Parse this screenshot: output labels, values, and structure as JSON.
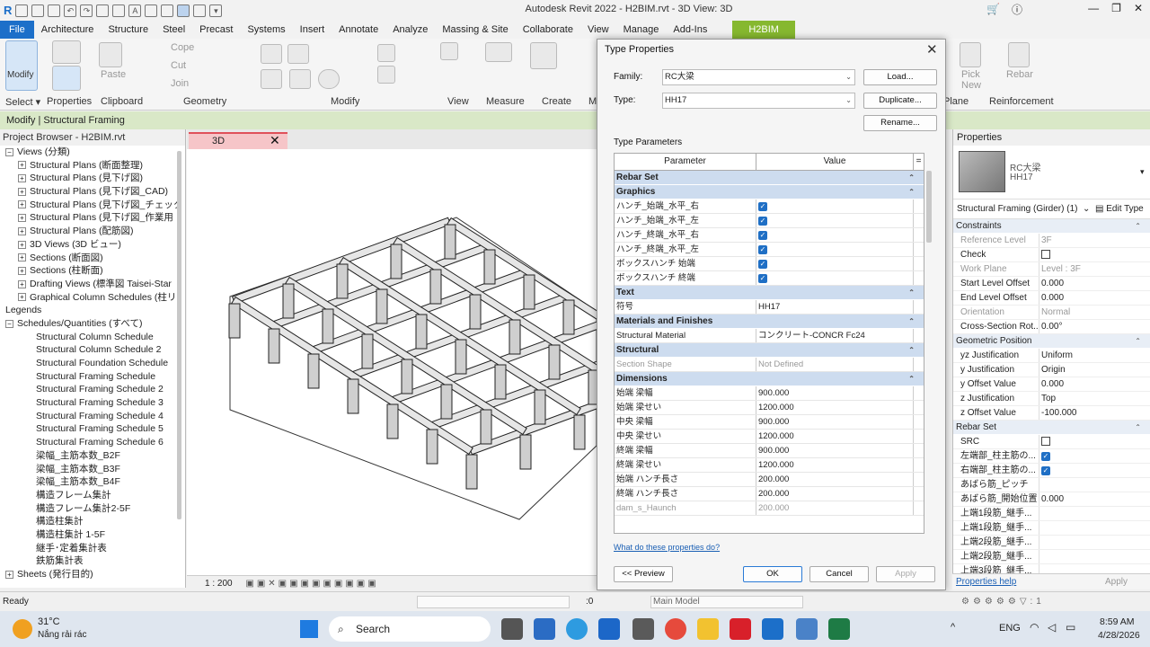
{
  "app": {
    "title": "Autodesk Revit 2022 - H2BIM.rvt - 3D View: 3D"
  },
  "ribbon_tabs": [
    "File",
    "Architecture",
    "Structure",
    "Steel",
    "Precast",
    "Systems",
    "Insert",
    "Annotate",
    "Analyze",
    "Massing & Site",
    "Collaborate",
    "View",
    "Manage",
    "Add-Ins"
  ],
  "context_tab": "H2BIM",
  "ribbon": {
    "modify": "Modify",
    "paste": "Paste",
    "cope": "Cope",
    "cut": "Cut",
    "join": "Join",
    "pick_new": "Pick New",
    "rebar": "Rebar",
    "panels": [
      "Select",
      "Properties",
      "Clipboard",
      "Geometry",
      "Modify",
      "View",
      "Measure",
      "Create",
      "M"
    ],
    "plane": "Plane",
    "reinforcement": "Reinforcement"
  },
  "modify_bar": "Modify | Structural Framing",
  "project_browser": {
    "title": "Project Browser - H2BIM.rvt",
    "items": [
      {
        "label": "Views (分類)",
        "indent": 1,
        "toggle": "−"
      },
      {
        "label": "Structural Plans (断面整理)",
        "indent": 2,
        "toggle": "+"
      },
      {
        "label": "Structural Plans (見下げ図)",
        "indent": 2,
        "toggle": "+"
      },
      {
        "label": "Structural Plans (見下げ図_CAD)",
        "indent": 2,
        "toggle": "+"
      },
      {
        "label": "Structural Plans (見下げ図_チェック",
        "indent": 2,
        "toggle": "+"
      },
      {
        "label": "Structural Plans (見下げ図_作業用",
        "indent": 2,
        "toggle": "+"
      },
      {
        "label": "Structural Plans (配筋図)",
        "indent": 2,
        "toggle": "+"
      },
      {
        "label": "3D Views (3D ビュー)",
        "indent": 2,
        "toggle": "+"
      },
      {
        "label": "Sections (断面図)",
        "indent": 2,
        "toggle": "+"
      },
      {
        "label": "Sections (柱断面)",
        "indent": 2,
        "toggle": "+"
      },
      {
        "label": "Drafting Views (標準図 Taisei-Star",
        "indent": 2,
        "toggle": "+"
      },
      {
        "label": "Graphical Column Schedules (柱リ",
        "indent": 2,
        "toggle": "+"
      },
      {
        "label": "Legends",
        "indent": 1,
        "toggle": ""
      },
      {
        "label": "Schedules/Quantities (すべて)",
        "indent": 1,
        "toggle": "−"
      },
      {
        "label": "Structural Column Schedule",
        "indent": 3,
        "toggle": ""
      },
      {
        "label": "Structural Column Schedule 2",
        "indent": 3,
        "toggle": ""
      },
      {
        "label": "Structural Foundation Schedule",
        "indent": 3,
        "toggle": ""
      },
      {
        "label": "Structural Framing Schedule",
        "indent": 3,
        "toggle": ""
      },
      {
        "label": "Structural Framing Schedule 2",
        "indent": 3,
        "toggle": ""
      },
      {
        "label": "Structural Framing Schedule 3",
        "indent": 3,
        "toggle": ""
      },
      {
        "label": "Structural Framing Schedule 4",
        "indent": 3,
        "toggle": ""
      },
      {
        "label": "Structural Framing Schedule 5",
        "indent": 3,
        "toggle": ""
      },
      {
        "label": "Structural Framing Schedule 6",
        "indent": 3,
        "toggle": ""
      },
      {
        "label": "梁幅_主筋本数_B2F",
        "indent": 3,
        "toggle": ""
      },
      {
        "label": "梁幅_主筋本数_B3F",
        "indent": 3,
        "toggle": ""
      },
      {
        "label": "梁幅_主筋本数_B4F",
        "indent": 3,
        "toggle": ""
      },
      {
        "label": "構造フレーム集計",
        "indent": 3,
        "toggle": ""
      },
      {
        "label": "構造フレーム集計2-5F",
        "indent": 3,
        "toggle": ""
      },
      {
        "label": "構造柱集計",
        "indent": 3,
        "toggle": ""
      },
      {
        "label": "構造柱集計 1-5F",
        "indent": 3,
        "toggle": ""
      },
      {
        "label": "継手･定着集計表",
        "indent": 3,
        "toggle": ""
      },
      {
        "label": "鉄筋集計表",
        "indent": 3,
        "toggle": ""
      },
      {
        "label": "Sheets (発行目的)",
        "indent": 1,
        "toggle": "+"
      }
    ]
  },
  "view": {
    "tab_label": "3D",
    "scale": "1 : 200"
  },
  "dialog": {
    "title": "Type Properties",
    "family_label": "Family:",
    "family_value": "RC大梁",
    "type_label": "Type:",
    "type_value": "HH17",
    "load": "Load...",
    "duplicate": "Duplicate...",
    "rename": "Rename...",
    "type_params_label": "Type Parameters",
    "col_parameter": "Parameter",
    "col_value": "Value",
    "col_eq": "=",
    "groups": [
      {
        "name": "Rebar Set",
        "rows": []
      },
      {
        "name": "Graphics",
        "rows": [
          {
            "p": "ハンチ_始端_水平_右",
            "check": true
          },
          {
            "p": "ハンチ_始端_水平_左",
            "check": true
          },
          {
            "p": "ハンチ_終端_水平_右",
            "check": true
          },
          {
            "p": "ハンチ_終端_水平_左",
            "check": true
          },
          {
            "p": "ボックスハンチ 始端",
            "check": true
          },
          {
            "p": "ボックスハンチ 終端",
            "check": true
          }
        ]
      },
      {
        "name": "Text",
        "rows": [
          {
            "p": "符号",
            "v": "HH17"
          }
        ]
      },
      {
        "name": "Materials and Finishes",
        "rows": [
          {
            "p": "Structural Material",
            "v": "コンクリート-CONCR Fc24"
          }
        ]
      },
      {
        "name": "Structural",
        "rows": [
          {
            "p": "Section Shape",
            "v": "Not Defined",
            "gray": true
          }
        ]
      },
      {
        "name": "Dimensions",
        "rows": [
          {
            "p": "始端 梁幅",
            "v": "900.000"
          },
          {
            "p": "始端 梁せい",
            "v": "1200.000"
          },
          {
            "p": "中央 梁幅",
            "v": "900.000"
          },
          {
            "p": "中央 梁せい",
            "v": "1200.000"
          },
          {
            "p": "終端 梁幅",
            "v": "900.000"
          },
          {
            "p": "終端 梁せい",
            "v": "1200.000"
          },
          {
            "p": "始端 ハンチ長さ",
            "v": "200.000"
          },
          {
            "p": "終端 ハンチ長さ",
            "v": "200.000"
          },
          {
            "p": "dam_s_Haunch",
            "v": "200.000",
            "gray": true
          }
        ]
      }
    ],
    "help_link": "What do these properties do?",
    "preview": "<< Preview",
    "ok": "OK",
    "cancel": "Cancel",
    "apply": "Apply"
  },
  "properties": {
    "title": "Properties",
    "family": "RC大梁",
    "type": "HH17",
    "selector": "Structural Framing (Girder) (1)",
    "edit_type": "Edit Type",
    "groups": [
      {
        "name": "Constraints",
        "rows": [
          {
            "n": "Reference Level",
            "v": "3F",
            "gray": true
          },
          {
            "n": "Check",
            "check": false
          },
          {
            "n": "Work Plane",
            "v": "Level : 3F",
            "gray": true
          },
          {
            "n": "Start Level Offset",
            "v": "0.000"
          },
          {
            "n": "End Level Offset",
            "v": "0.000"
          },
          {
            "n": "Orientation",
            "v": "Normal",
            "gray": true
          },
          {
            "n": "Cross-Section Rot...",
            "v": "0.00°"
          }
        ]
      },
      {
        "name": "Geometric Position",
        "rows": [
          {
            "n": "yz Justification",
            "v": "Uniform"
          },
          {
            "n": "y Justification",
            "v": "Origin"
          },
          {
            "n": "y Offset Value",
            "v": "0.000"
          },
          {
            "n": "z Justification",
            "v": "Top"
          },
          {
            "n": "z Offset Value",
            "v": "-100.000"
          }
        ]
      },
      {
        "name": "Rebar Set",
        "rows": [
          {
            "n": "SRC",
            "check": false
          },
          {
            "n": "左端部_柱主筋の...",
            "check": true
          },
          {
            "n": "右端部_柱主筋の...",
            "check": true
          },
          {
            "n": "あばら筋_ピッチ",
            "v": ""
          },
          {
            "n": "あばら筋_開始位置",
            "v": "0.000"
          },
          {
            "n": "上端1段筋_継手...",
            "v": ""
          },
          {
            "n": "上端1段筋_継手...",
            "v": ""
          },
          {
            "n": "上端2段筋_継手...",
            "v": ""
          },
          {
            "n": "上端2段筋_継手...",
            "v": ""
          },
          {
            "n": "上端3段筋_継手...",
            "v": ""
          }
        ]
      }
    ],
    "help": "Properties help",
    "apply": "Apply"
  },
  "status": {
    "left": "Ready",
    "zero": ":0",
    "model": "Main Model"
  },
  "taskbar": {
    "temp": "31°C",
    "weather": "Nắng rải rác",
    "search": "Search",
    "lang": "ENG",
    "time": "8:59 AM",
    "date": "4/28/2026"
  }
}
